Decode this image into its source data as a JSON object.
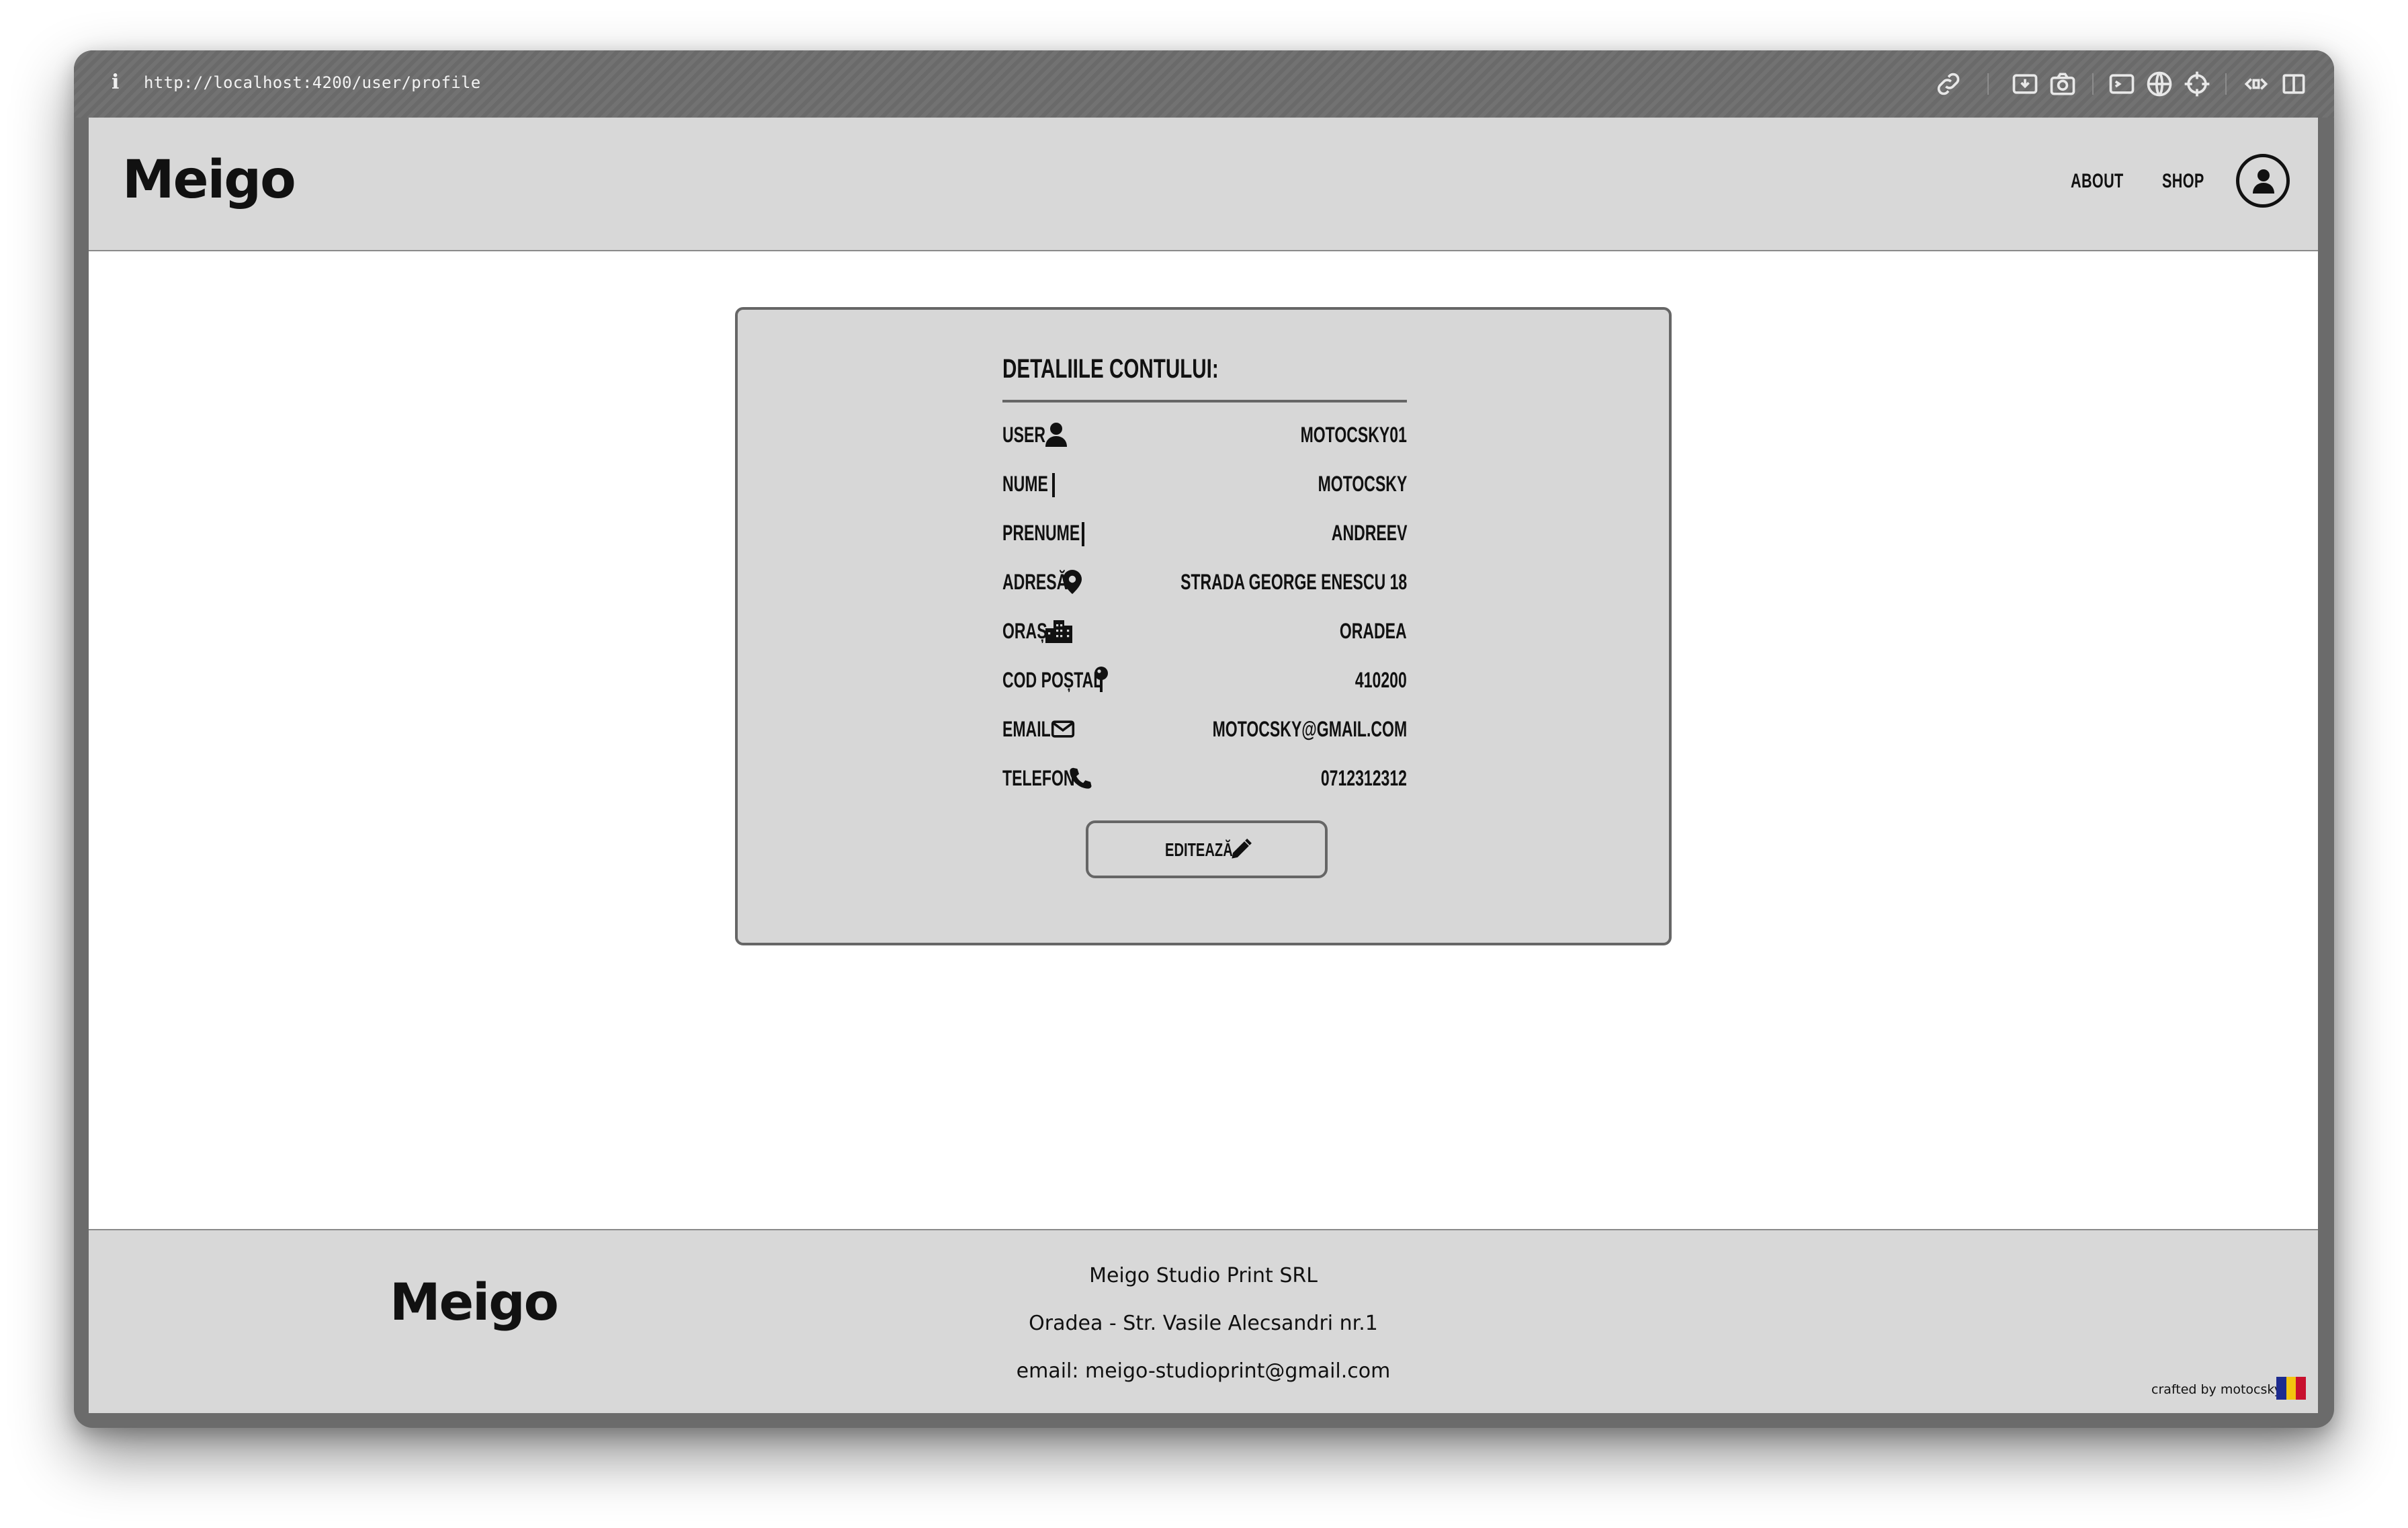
{
  "browser": {
    "info_glyph": "i",
    "url": "http://localhost:4200/user/profile",
    "toolbar_icons": [
      "link-icon",
      "screenshot-save-icon",
      "camera-icon",
      "terminal-icon",
      "globe-icon",
      "crosshair-icon",
      "extensions-icon",
      "sidebar-icon"
    ]
  },
  "header": {
    "logo": "Meigo",
    "nav": {
      "about": "ABOUT",
      "shop": "SHOP"
    },
    "account_icon": "user-circle-icon"
  },
  "profile": {
    "title": "DETALIILE CONTULUI:",
    "rows": [
      {
        "label": "USER",
        "icon": "user-icon",
        "value": "MOTOCSKY01"
      },
      {
        "label": "NUME",
        "icon": "bar-divider",
        "value": "MOTOCSKY"
      },
      {
        "label": "PRENUME",
        "icon": "bar-divider",
        "value": "ANDREEV"
      },
      {
        "label": "ADRESĂ",
        "icon": "location-pin-icon",
        "value": "STRADA GEORGE ENESCU 18"
      },
      {
        "label": "ORAȘ",
        "icon": "city-icon",
        "value": "ORADEA"
      },
      {
        "label": "COD POȘTAL",
        "icon": "map-pin-icon",
        "value": "410200"
      },
      {
        "label": "EMAIL",
        "icon": "envelope-icon",
        "value": "MOTOCSKY@GMAIL.COM"
      },
      {
        "label": "TELEFON",
        "icon": "phone-icon",
        "value": "0712312312"
      }
    ],
    "edit_button": {
      "label": "EDITEAZĂ",
      "icon": "pencil-icon"
    }
  },
  "footer": {
    "logo": "Meigo",
    "company": "Meigo Studio Print SRL",
    "address": "Oradea - Str. Vasile Alecsandri nr.1",
    "email": "email: meigo-studioprint@gmail.com",
    "crafted": "crafted by motocsky",
    "flag_colors": [
      "#1d2b8f",
      "#f2c40f",
      "#c8102e"
    ]
  }
}
